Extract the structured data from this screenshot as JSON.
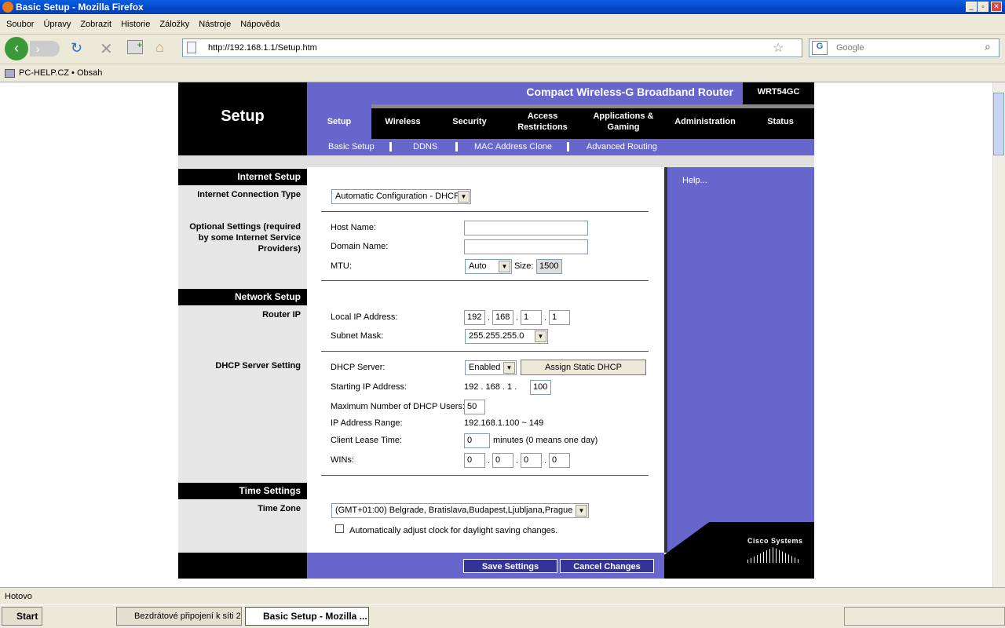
{
  "window": {
    "title": "Basic Setup - Mozilla Firefox"
  },
  "menu": [
    "Soubor",
    "Úpravy",
    "Zobrazit",
    "Historie",
    "Záložky",
    "Nástroje",
    "Nápověda"
  ],
  "toolbar": {
    "url": "http://192.168.1.1/Setup.htm",
    "search_placeholder": "Google"
  },
  "bookmarks": {
    "item": "PC-HELP.CZ • Obsah"
  },
  "router": {
    "product": "Compact Wireless-G Broadband Router",
    "model": "WRT54GC",
    "section": "Setup",
    "tabs": [
      "Setup",
      "Wireless",
      "Security",
      "Access Restrictions",
      "Applications & Gaming",
      "Administration",
      "Status"
    ],
    "subtabs": [
      "Basic Setup",
      "DDNS",
      "MAC Address Clone",
      "Advanced Routing"
    ],
    "help": "Help...",
    "brand": "Cisco Systems"
  },
  "form": {
    "internet_setup": "Internet Setup",
    "connection_type_label": "Internet Connection Type",
    "connection_type": "Automatic Configuration - DHCP",
    "optional_label": "Optional Settings (required by some Internet Service Providers)",
    "host_name": "Host Name:",
    "domain_name": "Domain Name:",
    "mtu": "MTU:",
    "mtu_value": "Auto",
    "size": "Size:",
    "size_value": "1500",
    "network_setup": "Network Setup",
    "router_ip": "Router IP",
    "local_ip": "Local IP Address:",
    "ip": [
      "192",
      "168",
      "1",
      "1"
    ],
    "subnet": "Subnet Mask:",
    "subnet_value": "255.255.255.0",
    "dhcp_setting": "DHCP Server Setting",
    "dhcp_server": "DHCP Server:",
    "dhcp_value": "Enabled",
    "assign_static": "Assign Static DHCP",
    "start_ip": "Starting IP Address:",
    "start_prefix": "192 . 168 . 1 .",
    "start_value": "100",
    "max_users": "Maximum Number of DHCP Users:",
    "max_value": "50",
    "range": "IP Address Range:",
    "range_value": "192.168.1.100 ~ 149",
    "lease": "Client Lease Time:",
    "lease_value": "0",
    "lease_hint": "minutes (0 means one day)",
    "wins": "WINs:",
    "wins_value": [
      "0",
      "0",
      "0",
      "0"
    ],
    "time_settings": "Time Settings",
    "time_zone": "Time Zone",
    "tz_value": "(GMT+01:00) Belgrade, Bratislava,Budapest,Ljubljana,Prague",
    "dst": "Automatically adjust clock for daylight saving changes.",
    "dst_checked": false,
    "save": "Save Settings",
    "cancel": "Cancel Changes"
  },
  "status": "Hotovo",
  "taskbar": {
    "start": "Start",
    "items": [
      "Bezdrátové připojení k síti 2",
      "Basic Setup - Mozilla ..."
    ]
  },
  "colors": {
    "purple": "#6666cc",
    "black": "#000000",
    "xp_blue": "#0346c8"
  }
}
